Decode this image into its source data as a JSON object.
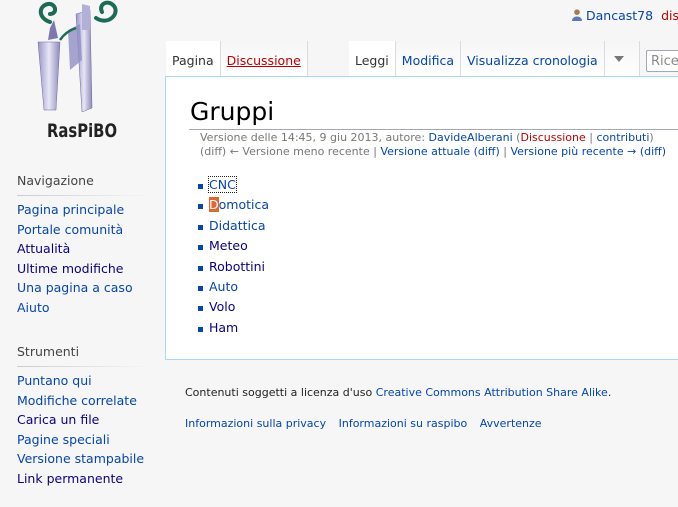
{
  "logo": {
    "text": "RasPiBO"
  },
  "personal": {
    "username": "Dancast78",
    "discussion_partial": "dis"
  },
  "tabs": {
    "page": "Pagina",
    "discussion": "Discussione",
    "read": "Leggi",
    "edit": "Modifica",
    "history": "Visualizza cronologia"
  },
  "search": {
    "placeholder": "Rice"
  },
  "sidebar": {
    "navigation": {
      "heading": "Navigazione",
      "items": [
        "Pagina principale",
        "Portale comunità",
        "Attualità",
        "Ultime modifiche",
        "Una pagina a caso",
        "Aiuto"
      ]
    },
    "tools": {
      "heading": "Strumenti",
      "items": [
        "Puntano qui",
        "Modifiche correlate",
        "Carica un file",
        "Pagine speciali",
        "Versione stampabile",
        "Link permanente"
      ]
    }
  },
  "content": {
    "title": "Gruppi",
    "revision": {
      "prefix": "Versione delle 14:45, 9 giu 2013, autore: ",
      "author": "DavideAlberani",
      "talk": "Discussione",
      "contribs": "contributi",
      "diff": "(diff)",
      "older": "← Versione meno recente",
      "current": "Versione attuale",
      "newer": "Versione più recente →"
    },
    "groups": [
      "CNC",
      "Domotica",
      "Didattica",
      "Meteo",
      "Robottini",
      "Auto",
      "Volo",
      "Ham"
    ]
  },
  "footer": {
    "license_text": "Contenuti soggetti a licenza d'uso ",
    "license_link": "Creative Commons Attribution Share Alike",
    "license_end": ".",
    "links": [
      "Informazioni sulla privacy",
      "Informazioni su raspibo",
      "Avvertenze"
    ]
  }
}
